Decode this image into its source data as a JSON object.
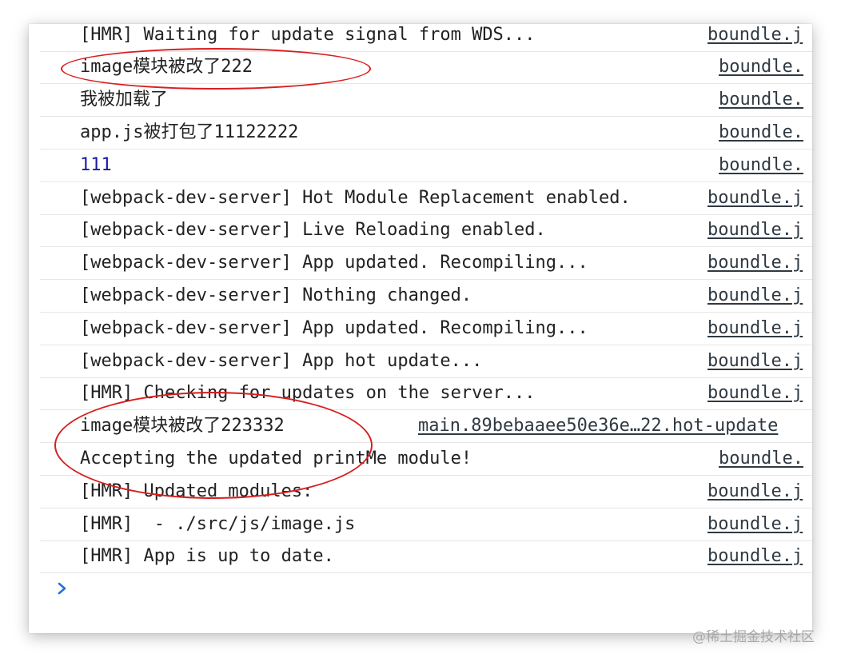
{
  "console": {
    "rows": [
      {
        "message": "[HMR] Waiting for update signal from WDS...",
        "source": "boundle.j",
        "type": "log"
      },
      {
        "message": "image模块被改了222",
        "source": "boundle.",
        "type": "log"
      },
      {
        "message": "我被加载了",
        "source": "boundle.",
        "type": "log"
      },
      {
        "message": "app.js被打包了11122222",
        "source": "boundle.",
        "type": "log"
      },
      {
        "message": "111",
        "source": "boundle.",
        "type": "number"
      },
      {
        "message": "[webpack-dev-server] Hot Module Replacement enabled.",
        "source": "boundle.j",
        "type": "log"
      },
      {
        "message": "[webpack-dev-server] Live Reloading enabled.",
        "source": "boundle.j",
        "type": "log"
      },
      {
        "message": "[webpack-dev-server] App updated. Recompiling...",
        "source": "boundle.j",
        "type": "log"
      },
      {
        "message": "[webpack-dev-server] Nothing changed.",
        "source": "boundle.j",
        "type": "log"
      },
      {
        "message": "[webpack-dev-server] App updated. Recompiling...",
        "source": "boundle.j",
        "type": "log"
      },
      {
        "message": "[webpack-dev-server] App hot update...",
        "source": "boundle.j",
        "type": "log"
      },
      {
        "message": "[HMR] Checking for updates on the server...",
        "source": "boundle.j",
        "type": "log"
      },
      {
        "message": "image模块被改了223332",
        "source": "main.89bebaaee50e36e…22.hot-update",
        "type": "log"
      },
      {
        "message": "Accepting the updated printMe module!",
        "source": "boundle.",
        "type": "log"
      },
      {
        "message": "[HMR] Updated modules:",
        "source": "boundle.j",
        "type": "log"
      },
      {
        "message": "[HMR]  - ./src/js/image.js",
        "source": "boundle.j",
        "type": "log"
      },
      {
        "message": "[HMR] App is up to date.",
        "source": "boundle.j",
        "type": "log"
      }
    ]
  },
  "prompt_icon": "chevron-right-icon",
  "colors": {
    "highlight": "#d81e1e",
    "number": "#1a1aa6",
    "prompt": "#1a73e8"
  },
  "watermark": "@稀土掘金技术社区"
}
